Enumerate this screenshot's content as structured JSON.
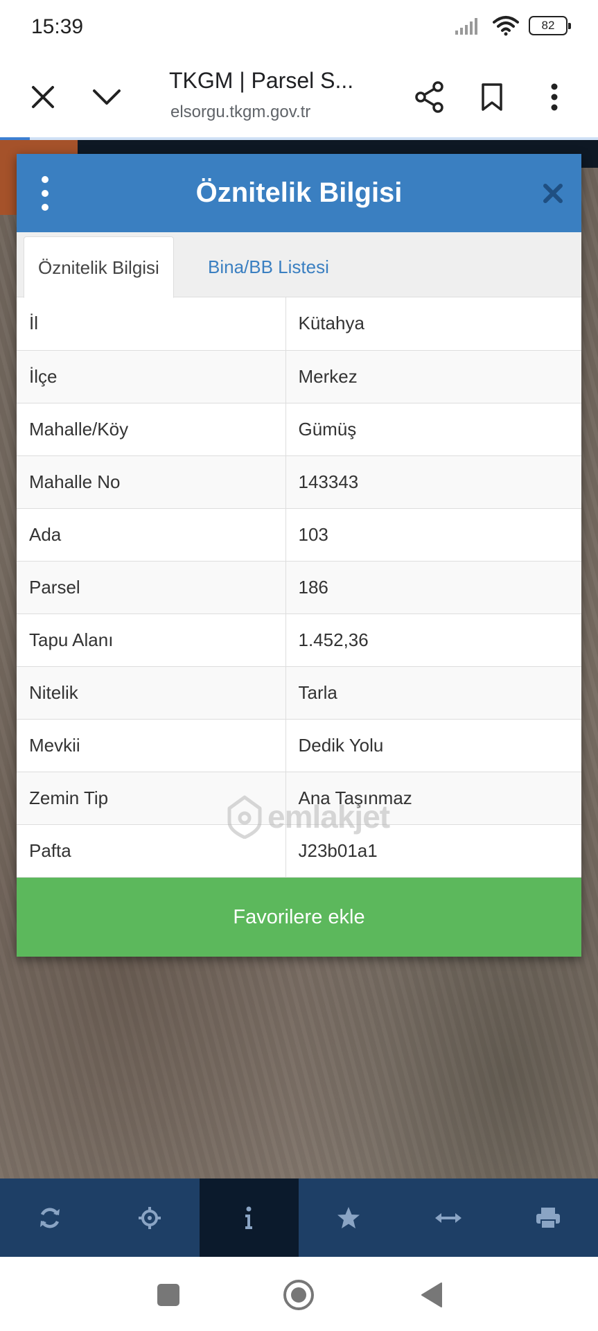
{
  "status_bar": {
    "time": "15:39",
    "battery": "82"
  },
  "browser": {
    "title": "TKGM | Parsel S...",
    "url": "elsorgu.tkgm.gov.tr",
    "progress": 0.05
  },
  "dialog": {
    "title": "Öznitelik Bilgisi",
    "tabs": [
      {
        "label": "Öznitelik Bilgisi",
        "active": true
      },
      {
        "label": "Bina/BB Listesi",
        "active": false
      }
    ],
    "rows": [
      {
        "key": "İl",
        "value": "Kütahya"
      },
      {
        "key": "İlçe",
        "value": "Merkez"
      },
      {
        "key": "Mahalle/Köy",
        "value": "Gümüş"
      },
      {
        "key": "Mahalle No",
        "value": "143343"
      },
      {
        "key": "Ada",
        "value": "103"
      },
      {
        "key": "Parsel",
        "value": "186"
      },
      {
        "key": "Tapu Alanı",
        "value": "1.452,36"
      },
      {
        "key": "Nitelik",
        "value": "Tarla"
      },
      {
        "key": "Mevkii",
        "value": "Dedik Yolu"
      },
      {
        "key": "Zemin Tip",
        "value": "Ana Taşınmaz"
      },
      {
        "key": "Pafta",
        "value": "J23b01a1"
      }
    ],
    "favorite_button": "Favorilere ekle"
  },
  "watermark": "emlakjet",
  "toolbar": {
    "items": [
      {
        "icon": "refresh-icon",
        "active": false
      },
      {
        "icon": "crosshair-icon",
        "active": false
      },
      {
        "icon": "info-icon",
        "active": true
      },
      {
        "icon": "star-icon",
        "active": false
      },
      {
        "icon": "measure-icon",
        "active": false
      },
      {
        "icon": "print-icon",
        "active": false
      }
    ]
  },
  "colors": {
    "header_blue": "#3a7fc1",
    "favorite_green": "#5cb85c",
    "toolbar_navy": "#1e3f66",
    "toolbar_active": "#0b1a2c"
  }
}
